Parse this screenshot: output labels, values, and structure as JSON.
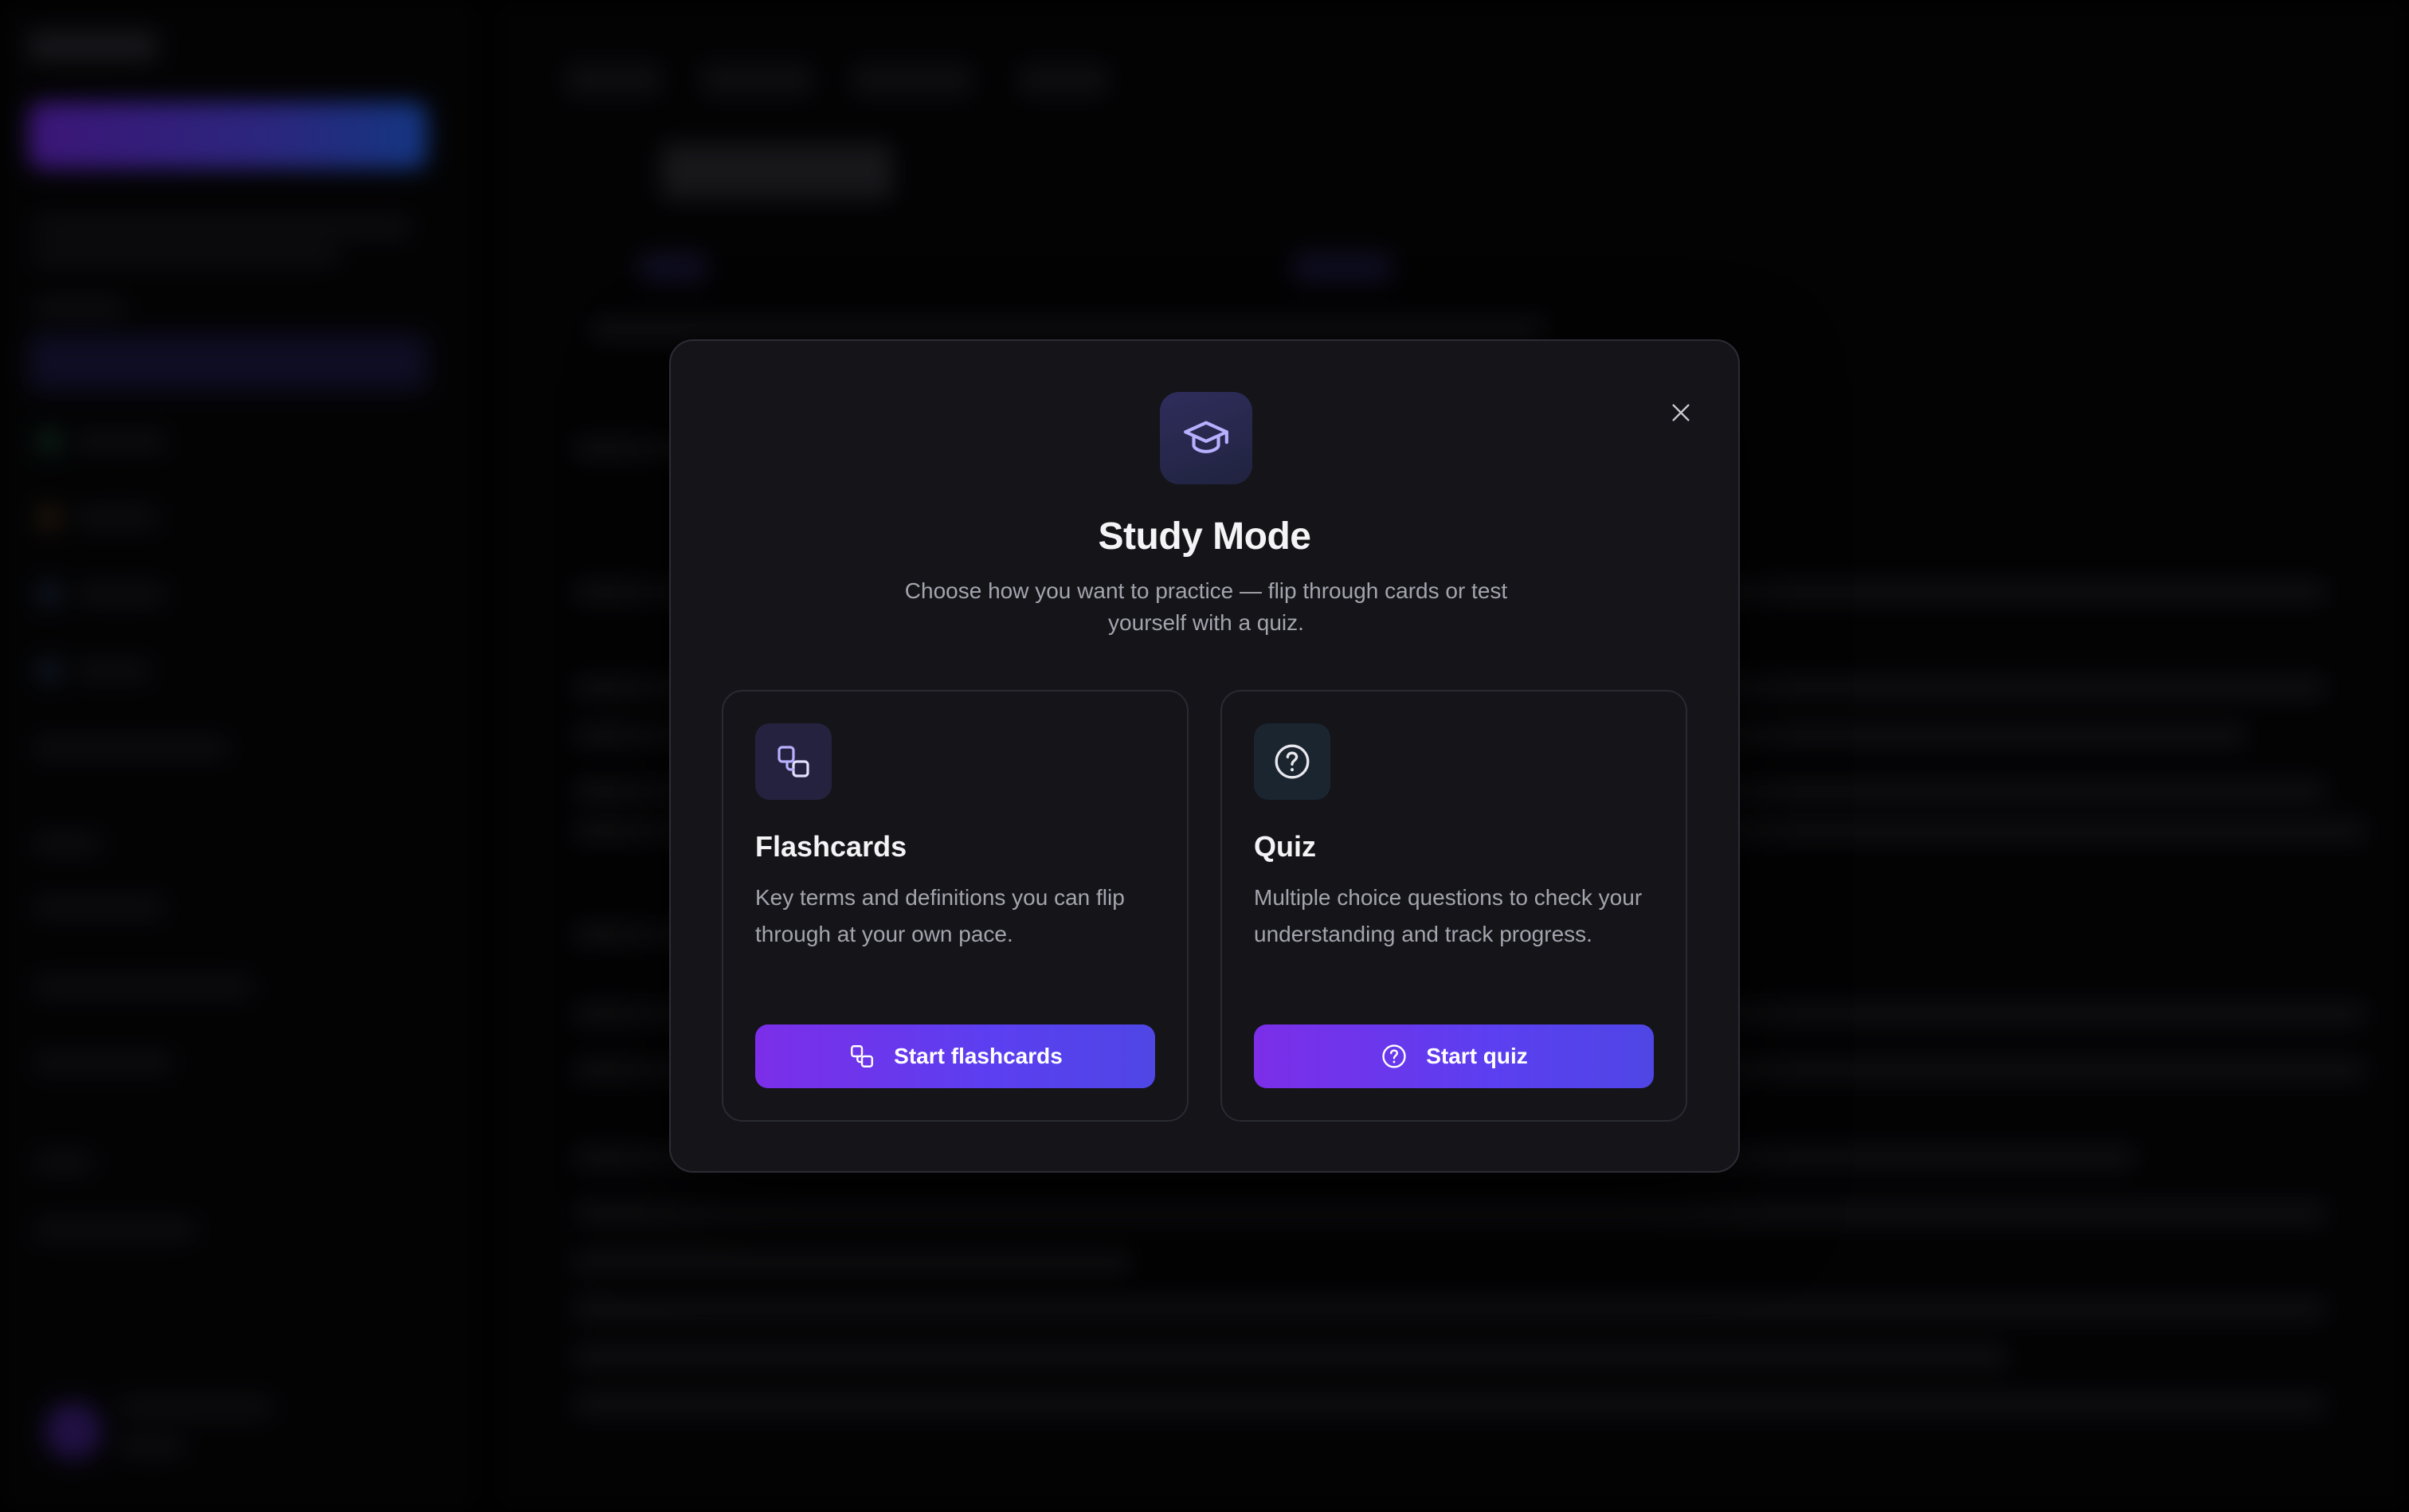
{
  "modal": {
    "title": "Study Mode",
    "subtitle": "Choose how you want to practice — flip through cards or test yourself with a quiz.",
    "hero_icon": "graduation-cap-icon",
    "close_icon": "close-icon",
    "cards": [
      {
        "id": "flashcards",
        "icon": "flashcards-icon",
        "title": "Flashcards",
        "description": "Key terms and definitions you can flip through at your own pace.",
        "button_label": "Start flashcards"
      },
      {
        "id": "quiz",
        "icon": "question-circle-icon",
        "title": "Quiz",
        "description": "Multiple choice questions to check your understanding and track progress.",
        "button_label": "Start quiz"
      }
    ]
  },
  "colors": {
    "accent_start": "#7c2ee8",
    "accent_end": "#4f46e5",
    "modal_bg": "#141419",
    "text_primary": "#f4f4f6",
    "text_secondary": "#a4a4ae",
    "icon_accent": "#b7b0ff"
  }
}
